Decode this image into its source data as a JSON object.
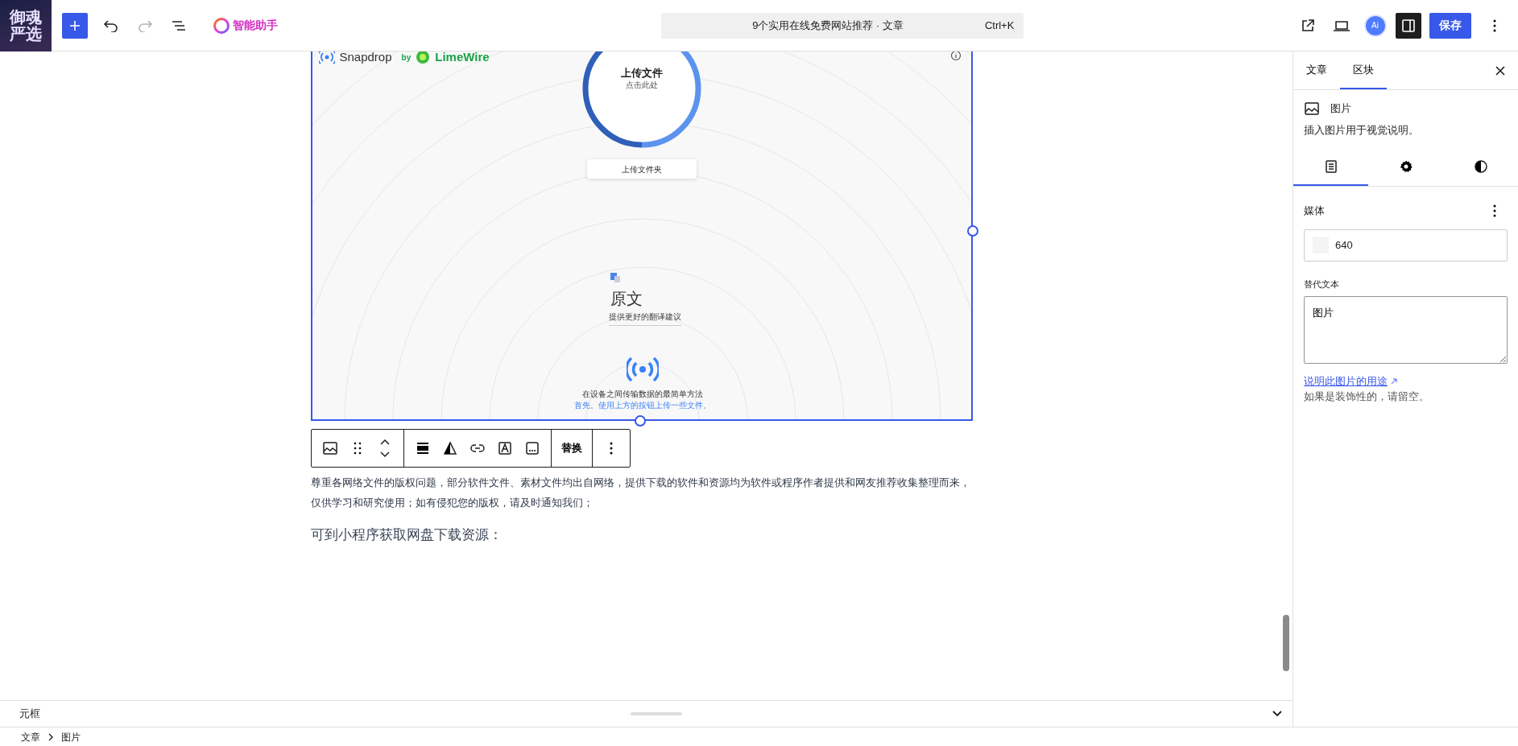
{
  "topbar": {
    "logo_lines": [
      "御魂",
      "严选"
    ],
    "undo": {
      "disabled": false
    },
    "redo": {
      "disabled": true
    },
    "assistant": "智能助手",
    "title": "9个实用在线免费网站推荐 · 文章",
    "shortcut": "Ctrl+K",
    "ai_badge": "Ai",
    "settings_toggle": {
      "pressed": true
    },
    "save": "保存"
  },
  "image": {
    "brand": "Snapdrop",
    "by": "by",
    "partner": "LimeWire",
    "upload_title": "上传文件",
    "upload_hint": "点击此处",
    "folder_button": "上传文件夹",
    "translate_title": "原文",
    "translate_hint": "提供更好的翻译建议",
    "tagline": "在设备之间传输数据的最简单方法",
    "tagline_hint": "首先。使用上方的按钮上传一些文件。",
    "selected": true
  },
  "block_toolbar": {
    "replace": "替换"
  },
  "content": [
    {
      "kind": "paragraph",
      "text": "尊重各网络文件的版权问题，部分软件文件、素材文件均出自网络，提供下载的软件和资源均为软件或程序作者提供和网友推荐收集整理而来，仅供学习和研究使用；如有侵犯您的版权，请及时通知我们；"
    },
    {
      "kind": "heading",
      "text": "可到小程序获取网盘下载资源："
    }
  ],
  "sidebar": {
    "tabs": [
      {
        "label": "文章",
        "selected": false
      },
      {
        "label": "区块",
        "selected": true
      }
    ],
    "block_title": "图片",
    "block_description": "插入图片用于视觉说明。",
    "panel_tabs": [
      {
        "kind": "document",
        "selected": true
      },
      {
        "kind": "settings",
        "selected": false
      },
      {
        "kind": "styles",
        "selected": false
      }
    ],
    "media_label": "媒体",
    "media_value": "640",
    "alt_label": "替代文本",
    "alt_value": "图片",
    "help_link": "说明此图片的用途",
    "help_text": "如果是装饰性的，请留空。"
  },
  "meta_box": {
    "title": "元框",
    "expanded": false
  },
  "breadcrumb": [
    "文章",
    "图片"
  ]
}
